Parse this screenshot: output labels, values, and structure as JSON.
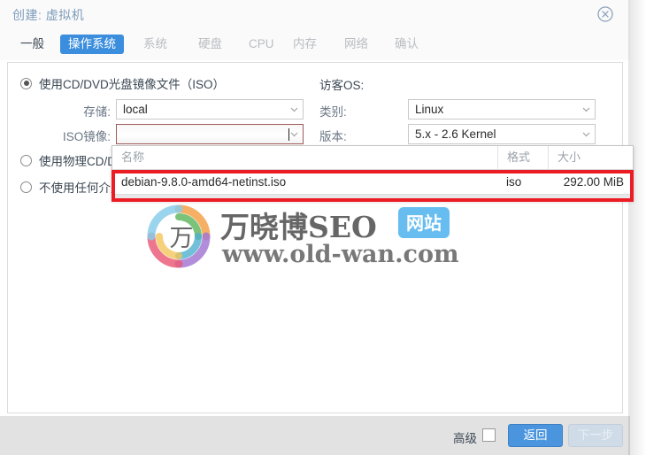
{
  "window": {
    "title": "创建: 虚拟机",
    "close_icon": "close-circle-icon"
  },
  "tabs": [
    {
      "label": "一般",
      "active": false
    },
    {
      "label": "操作系统",
      "active": true
    },
    {
      "label": "系统",
      "active": false
    },
    {
      "label": "硬盘",
      "active": false
    },
    {
      "label": "CPU",
      "active": false
    },
    {
      "label": "内存",
      "active": false
    },
    {
      "label": "网络",
      "active": false
    },
    {
      "label": "确认",
      "active": false
    }
  ],
  "form": {
    "media_options": [
      {
        "label": "使用CD/DVD光盘镜像文件（ISO）",
        "selected": true
      },
      {
        "label": "使用物理CD/DVD驱动器",
        "selected": false
      },
      {
        "label": "不使用任何介质",
        "selected": false
      }
    ],
    "storage_label": "存储:",
    "storage_value": "local",
    "iso_label": "ISO镜像:",
    "iso_value": "",
    "guest_os_label": "访客OS:",
    "category_label": "类别:",
    "category_value": "Linux",
    "version_label": "版本:",
    "version_value": "5.x - 2.6 Kernel"
  },
  "dropdown": {
    "columns": [
      "名称",
      "格式",
      "大小"
    ],
    "rows": [
      {
        "name": "debian-9.8.0-amd64-netinst.iso",
        "format": "iso",
        "size": "292.00 MiB"
      }
    ]
  },
  "annotation": {
    "highlight_color": "#ec1c24"
  },
  "watermark": {
    "brand_cn": "万晓博SEO",
    "badge": "网站",
    "url": "www.old-wan.com",
    "logo_glyph": "万"
  },
  "footer": {
    "advanced_label": "高级",
    "back_label": "返回",
    "next_label": "下一步"
  },
  "colors": {
    "accent_blue": "#3b8ddd",
    "title_blue": "#7e9cbb",
    "annotation_red": "#ec1c24",
    "badge_blue": "#5bb8ee"
  }
}
